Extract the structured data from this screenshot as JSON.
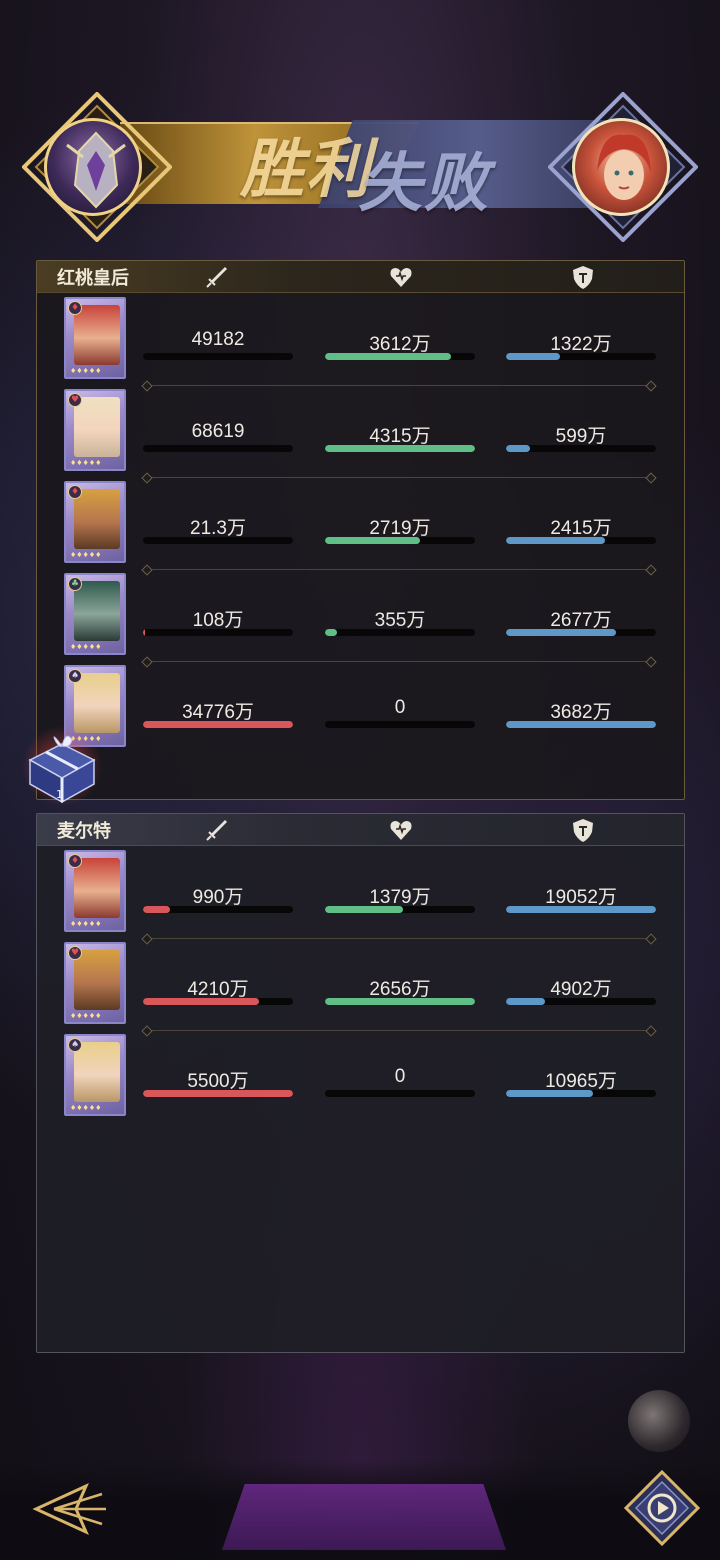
{
  "banner": {
    "win_text": "胜利",
    "lose_text": "失败",
    "left_avatar_icon": "armored-knight-avatar",
    "right_avatar_icon": "red-haired-queen-avatar"
  },
  "colors": {
    "attack_bar": "#d9575a",
    "hp_bar": "#5fbf86",
    "defense_bar": "#5e98c8",
    "gold_accent": "#e6c27a",
    "panel_bg": "#1a181c"
  },
  "stat_icons": [
    "sword-icon",
    "heart-icon",
    "shield-icon"
  ],
  "teams": [
    {
      "name": "红桃皇后",
      "members": [
        {
          "portrait": "red-haired-queen-card",
          "suit": "♦",
          "attack": "49182",
          "attack_fill": 0.0,
          "hp": "3612万",
          "hp_fill": 0.84,
          "defense": "1322万",
          "defense_fill": 0.36
        },
        {
          "portrait": "blonde-lady-card",
          "suit": "♥",
          "attack": "68619",
          "attack_fill": 0.0,
          "hp": "4315万",
          "hp_fill": 1.0,
          "defense": "599万",
          "defense_fill": 0.16
        },
        {
          "portrait": "bearded-king-card",
          "suit": "♦",
          "attack": "21.3万",
          "attack_fill": 0.0,
          "hp": "2719万",
          "hp_fill": 0.63,
          "defense": "2415万",
          "defense_fill": 0.66
        },
        {
          "portrait": "green-haired-elf-card",
          "suit": "♣",
          "attack": "108万",
          "attack_fill": 0.01,
          "hp": "355万",
          "hp_fill": 0.08,
          "defense": "2677万",
          "defense_fill": 0.73
        },
        {
          "portrait": "golden-haired-maiden-card",
          "suit": "♠",
          "attack": "34776万",
          "attack_fill": 1.0,
          "hp": "0",
          "hp_fill": 0.0,
          "defense": "3682万",
          "defense_fill": 1.0
        }
      ]
    },
    {
      "name": "麦尔特",
      "members": [
        {
          "portrait": "red-haired-queen-card",
          "suit": "♦",
          "attack": "990万",
          "attack_fill": 0.18,
          "hp": "1379万",
          "hp_fill": 0.52,
          "defense": "19052万",
          "defense_fill": 1.0
        },
        {
          "portrait": "bearded-king-card",
          "suit": "♥",
          "attack": "4210万",
          "attack_fill": 0.77,
          "hp": "2656万",
          "hp_fill": 1.0,
          "defense": "4902万",
          "defense_fill": 0.26
        },
        {
          "portrait": "golden-haired-maiden-card",
          "suit": "♠",
          "attack": "5500万",
          "attack_fill": 1.0,
          "hp": "0",
          "hp_fill": 0.0,
          "defense": "10965万",
          "defense_fill": 0.58
        }
      ]
    }
  ],
  "gift": {
    "icon": "gift-box-icon",
    "count": "1"
  },
  "bottom": {
    "back_icon": "back-arrow-icon",
    "replay_icon": "replay-play-icon"
  }
}
